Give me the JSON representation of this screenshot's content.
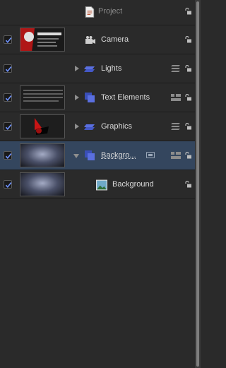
{
  "layers": {
    "project": {
      "label": "Project"
    },
    "rows": [
      {
        "label": "Camera",
        "checked": true
      },
      {
        "label": "Lights",
        "checked": true
      },
      {
        "label": "Text Elements",
        "checked": true
      },
      {
        "label": "Graphics",
        "checked": true
      },
      {
        "label": "Backgro...",
        "checked": true,
        "selected": true
      },
      {
        "label": "Background",
        "checked": true
      }
    ]
  },
  "colors": {
    "panel_bg": "#2a2a2a",
    "selected_row_bg": "#34465e",
    "group_icon_blue": "#4f63d8",
    "checkmark_blue": "#6f93ff",
    "text": "#dcdcdc",
    "dim_text": "#8a8a8a"
  },
  "icons": {
    "project": "document-icon",
    "camera": "camera-icon",
    "group": "layer-group-icon",
    "image": "image-icon",
    "lock": "lock-icon",
    "disclosure": "disclosure-triangle-icon",
    "mask": "mask-badge-icon",
    "stack": "stack-icon"
  }
}
